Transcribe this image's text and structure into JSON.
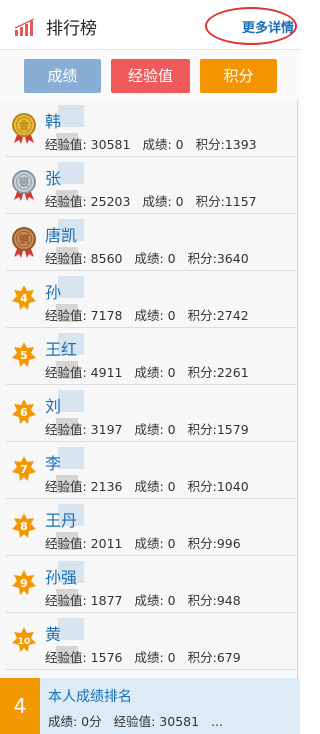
{
  "header": {
    "title": "排行榜",
    "more_link": "更多详情"
  },
  "tabs": [
    {
      "label": "成绩",
      "color": "#88aed6"
    },
    {
      "label": "经验值",
      "color": "#ef5b5b"
    },
    {
      "label": "积分",
      "color": "#f39500"
    }
  ],
  "rows": [
    {
      "rank": "金",
      "badge": "gold",
      "name": "韩",
      "exp_label": "经验值: 30581",
      "score_label": "成绩: 0",
      "points_label": "积分:1393"
    },
    {
      "rank": "银",
      "badge": "silver",
      "name": "张",
      "exp_label": "经验值: 25203",
      "score_label": "成绩: 0",
      "points_label": "积分:1157"
    },
    {
      "rank": "铜",
      "badge": "bronze",
      "name": "唐凯",
      "exp_label": "经验值: 8560",
      "score_label": "成绩: 0",
      "points_label": "积分:3640"
    },
    {
      "rank": "4",
      "badge": "orange",
      "name": "孙",
      "exp_label": "经验值: 7178",
      "score_label": "成绩: 0",
      "points_label": "积分:2742"
    },
    {
      "rank": "5",
      "badge": "orange",
      "name": "王红",
      "exp_label": "经验值: 4911",
      "score_label": "成绩: 0",
      "points_label": "积分:2261"
    },
    {
      "rank": "6",
      "badge": "orange",
      "name": "刘",
      "exp_label": "经验值: 3197",
      "score_label": "成绩: 0",
      "points_label": "积分:1579"
    },
    {
      "rank": "7",
      "badge": "orange",
      "name": "李",
      "exp_label": "经验值: 2136",
      "score_label": "成绩: 0",
      "points_label": "积分:1040"
    },
    {
      "rank": "8",
      "badge": "orange",
      "name": "王丹",
      "exp_label": "经验值: 2011",
      "score_label": "成绩: 0",
      "points_label": "积分:996"
    },
    {
      "rank": "9",
      "badge": "orange",
      "name": "孙强",
      "exp_label": "经验值: 1877",
      "score_label": "成绩: 0",
      "points_label": "积分:948"
    },
    {
      "rank": "10",
      "badge": "orange",
      "name": "黄",
      "exp_label": "经验值: 1576",
      "score_label": "成绩: 0",
      "points_label": "积分:679"
    }
  ],
  "mine": {
    "rank": "4",
    "label": "本人成绩排名",
    "score_label": "成绩: 0分",
    "exp_label": "经验值: 30581",
    "ellipsis": "..."
  }
}
